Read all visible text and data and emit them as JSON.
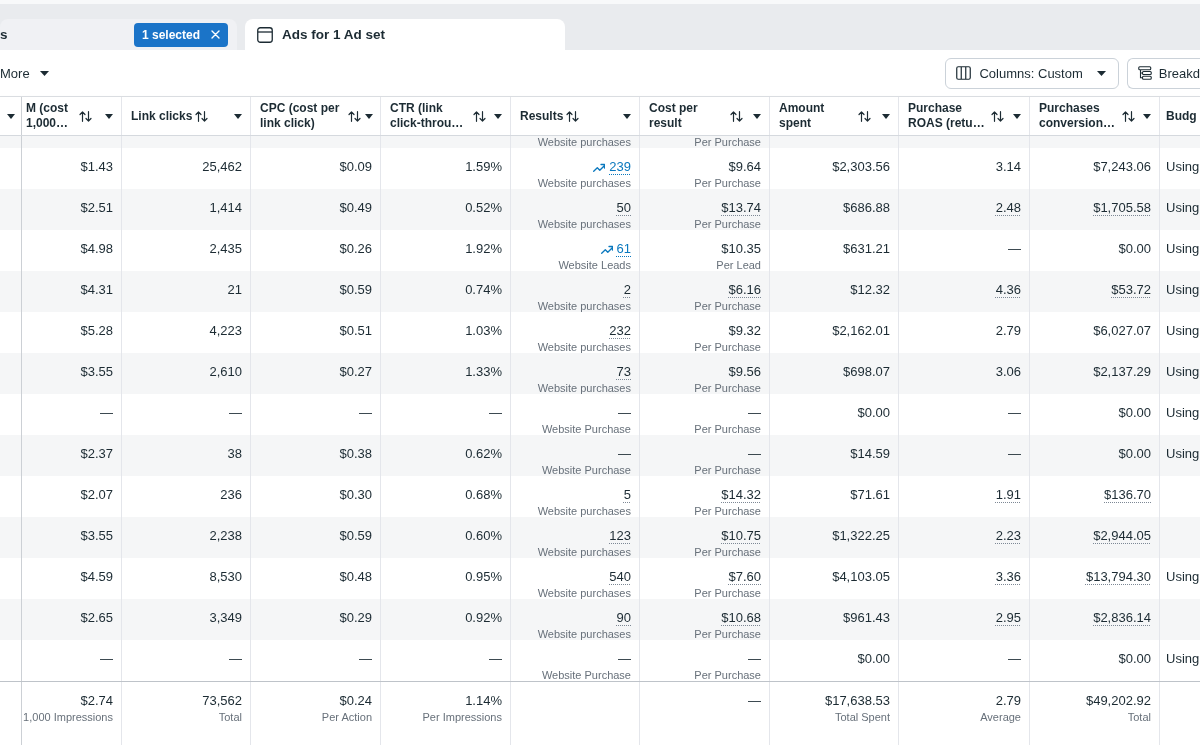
{
  "tabs": [
    {
      "label": "s",
      "selected": false,
      "icon": false,
      "badge": "1 selected"
    },
    {
      "label": "Ads for 1 Ad set",
      "selected": true,
      "icon": true
    }
  ],
  "toolbar": {
    "more_button": "More",
    "columns_button": "Columns: Custom",
    "clipped_button": "Breakd"
  },
  "table": {
    "columns": [
      {
        "label": "M (cost 1,000…"
      },
      {
        "label": "Link clicks"
      },
      {
        "label": "CPC (cost per link click)"
      },
      {
        "label": "CTR (link click-throu…"
      },
      {
        "label": "Results"
      },
      {
        "label": "Cost per result"
      },
      {
        "label": "Amount spent"
      },
      {
        "label": "Purchase ROAS (retu…"
      },
      {
        "label": "Purchases conversion…"
      },
      {
        "label": "Budg"
      }
    ],
    "clipped_row": {
      "cells": [
        null,
        null,
        null,
        null,
        {
          "sub": "Website purchases"
        },
        {
          "sub": "Per Purchase"
        },
        null,
        null,
        null,
        null
      ]
    },
    "rows": [
      {
        "cells": [
          {
            "value": "$1.43"
          },
          {
            "value": "25,462"
          },
          {
            "value": "$0.09"
          },
          {
            "value": "1.59%"
          },
          {
            "value": "239",
            "sub": "Website purchases",
            "trend": true,
            "dotted": true
          },
          {
            "value": "$9.64",
            "sub": "Per Purchase",
            "dotted": false
          },
          {
            "value": "$2,303.56"
          },
          {
            "value": "3.14",
            "dotted": false
          },
          {
            "value": "$7,243.06",
            "dotted": false
          },
          {
            "value": "Using"
          }
        ]
      },
      {
        "cells": [
          {
            "value": "$2.51"
          },
          {
            "value": "1,414"
          },
          {
            "value": "$0.49"
          },
          {
            "value": "0.52%"
          },
          {
            "value": "50",
            "sub": "Website purchases",
            "trend": false,
            "dotted": true
          },
          {
            "value": "$13.74",
            "sub": "Per Purchase",
            "dotted": true
          },
          {
            "value": "$686.88"
          },
          {
            "value": "2.48",
            "dotted": true
          },
          {
            "value": "$1,705.58",
            "dotted": true
          },
          {
            "value": "Using"
          }
        ]
      },
      {
        "cells": [
          {
            "value": "$4.98"
          },
          {
            "value": "2,435"
          },
          {
            "value": "$0.26"
          },
          {
            "value": "1.92%"
          },
          {
            "value": "61",
            "sub": "Website Leads",
            "trend": true,
            "dotted": true
          },
          {
            "value": "$10.35",
            "sub": "Per Lead",
            "dotted": false
          },
          {
            "value": "$631.21"
          },
          {
            "value": "—",
            "dotted": false
          },
          {
            "value": "$0.00",
            "dotted": false
          },
          {
            "value": "Using"
          }
        ]
      },
      {
        "cells": [
          {
            "value": "$4.31"
          },
          {
            "value": "21"
          },
          {
            "value": "$0.59"
          },
          {
            "value": "0.74%"
          },
          {
            "value": "2",
            "sub": "Website purchases",
            "trend": false,
            "dotted": true
          },
          {
            "value": "$6.16",
            "sub": "Per Purchase",
            "dotted": true
          },
          {
            "value": "$12.32"
          },
          {
            "value": "4.36",
            "dotted": true
          },
          {
            "value": "$53.72",
            "dotted": true
          },
          {
            "value": "Using"
          }
        ]
      },
      {
        "cells": [
          {
            "value": "$5.28"
          },
          {
            "value": "4,223"
          },
          {
            "value": "$0.51"
          },
          {
            "value": "1.03%"
          },
          {
            "value": "232",
            "sub": "Website purchases",
            "trend": false,
            "dotted": true
          },
          {
            "value": "$9.32",
            "sub": "Per Purchase",
            "dotted": false
          },
          {
            "value": "$2,162.01"
          },
          {
            "value": "2.79",
            "dotted": false
          },
          {
            "value": "$6,027.07",
            "dotted": false
          },
          {
            "value": "Using"
          }
        ]
      },
      {
        "cells": [
          {
            "value": "$3.55"
          },
          {
            "value": "2,610"
          },
          {
            "value": "$0.27"
          },
          {
            "value": "1.33%"
          },
          {
            "value": "73",
            "sub": "Website purchases",
            "trend": false,
            "dotted": true
          },
          {
            "value": "$9.56",
            "sub": "Per Purchase",
            "dotted": false
          },
          {
            "value": "$698.07"
          },
          {
            "value": "3.06",
            "dotted": false
          },
          {
            "value": "$2,137.29",
            "dotted": false
          },
          {
            "value": "Using"
          }
        ]
      },
      {
        "cells": [
          {
            "value": "—"
          },
          {
            "value": "—"
          },
          {
            "value": "—"
          },
          {
            "value": "—"
          },
          {
            "value": "—",
            "sub": "Website Purchase",
            "trend": false,
            "dotted": false
          },
          {
            "value": "—",
            "sub": "Per Purchase",
            "dotted": false
          },
          {
            "value": "$0.00"
          },
          {
            "value": "—",
            "dotted": false
          },
          {
            "value": "$0.00",
            "dotted": false
          },
          {
            "value": "Using"
          }
        ]
      },
      {
        "cells": [
          {
            "value": "$2.37"
          },
          {
            "value": "38"
          },
          {
            "value": "$0.38"
          },
          {
            "value": "0.62%"
          },
          {
            "value": "—",
            "sub": "Website Purchase",
            "trend": false,
            "dotted": false
          },
          {
            "value": "—",
            "sub": "Per Purchase",
            "dotted": false
          },
          {
            "value": "$14.59"
          },
          {
            "value": "—",
            "dotted": false
          },
          {
            "value": "$0.00",
            "dotted": false
          },
          {
            "value": "Using"
          }
        ]
      },
      {
        "cells": [
          {
            "value": "$2.07"
          },
          {
            "value": "236"
          },
          {
            "value": "$0.30"
          },
          {
            "value": "0.68%"
          },
          {
            "value": "5",
            "sub": "Website purchases",
            "trend": false,
            "dotted": true
          },
          {
            "value": "$14.32",
            "sub": "Per Purchase",
            "dotted": true
          },
          {
            "value": "$71.61"
          },
          {
            "value": "1.91",
            "dotted": true
          },
          {
            "value": "$136.70",
            "dotted": true
          },
          null
        ]
      },
      {
        "cells": [
          {
            "value": "$3.55"
          },
          {
            "value": "2,238"
          },
          {
            "value": "$0.59"
          },
          {
            "value": "0.60%"
          },
          {
            "value": "123",
            "sub": "Website purchases",
            "trend": false,
            "dotted": true
          },
          {
            "value": "$10.75",
            "sub": "Per Purchase",
            "dotted": true
          },
          {
            "value": "$1,322.25"
          },
          {
            "value": "2.23",
            "dotted": true
          },
          {
            "value": "$2,944.05",
            "dotted": true
          },
          null
        ]
      },
      {
        "cells": [
          {
            "value": "$4.59"
          },
          {
            "value": "8,530"
          },
          {
            "value": "$0.48"
          },
          {
            "value": "0.95%"
          },
          {
            "value": "540",
            "sub": "Website purchases",
            "trend": false,
            "dotted": true
          },
          {
            "value": "$7.60",
            "sub": "Per Purchase",
            "dotted": true
          },
          {
            "value": "$4,103.05"
          },
          {
            "value": "3.36",
            "dotted": true
          },
          {
            "value": "$13,794.30",
            "dotted": true
          },
          {
            "value": "Using"
          }
        ]
      },
      {
        "cells": [
          {
            "value": "$2.65"
          },
          {
            "value": "3,349"
          },
          {
            "value": "$0.29"
          },
          {
            "value": "0.92%"
          },
          {
            "value": "90",
            "sub": "Website purchases",
            "trend": false,
            "dotted": true
          },
          {
            "value": "$10.68",
            "sub": "Per Purchase",
            "dotted": true
          },
          {
            "value": "$961.43"
          },
          {
            "value": "2.95",
            "dotted": true
          },
          {
            "value": "$2,836.14",
            "dotted": true
          },
          null
        ]
      },
      {
        "cells": [
          {
            "value": "—"
          },
          {
            "value": "—"
          },
          {
            "value": "—"
          },
          {
            "value": "—"
          },
          {
            "value": "—",
            "sub": "Website Purchase",
            "trend": false,
            "dotted": false
          },
          {
            "value": "—",
            "sub": "Per Purchase",
            "dotted": false
          },
          {
            "value": "$0.00"
          },
          {
            "value": "—",
            "dotted": false
          },
          {
            "value": "$0.00",
            "dotted": false
          },
          {
            "value": "Using"
          }
        ]
      }
    ],
    "totals": {
      "cells": [
        {
          "value": "$2.74",
          "sub": "1,000 Impressions"
        },
        {
          "value": "73,562",
          "sub": "Total"
        },
        {
          "value": "$0.24",
          "sub": "Per Action"
        },
        {
          "value": "1.14%",
          "sub": "Per Impressions"
        },
        null,
        {
          "value": "—"
        },
        {
          "value": "$17,638.53",
          "sub": "Total Spent"
        },
        {
          "value": "2.79",
          "sub": "Average"
        },
        {
          "value": "$49,202.92",
          "sub": "Total"
        },
        null
      ]
    }
  }
}
